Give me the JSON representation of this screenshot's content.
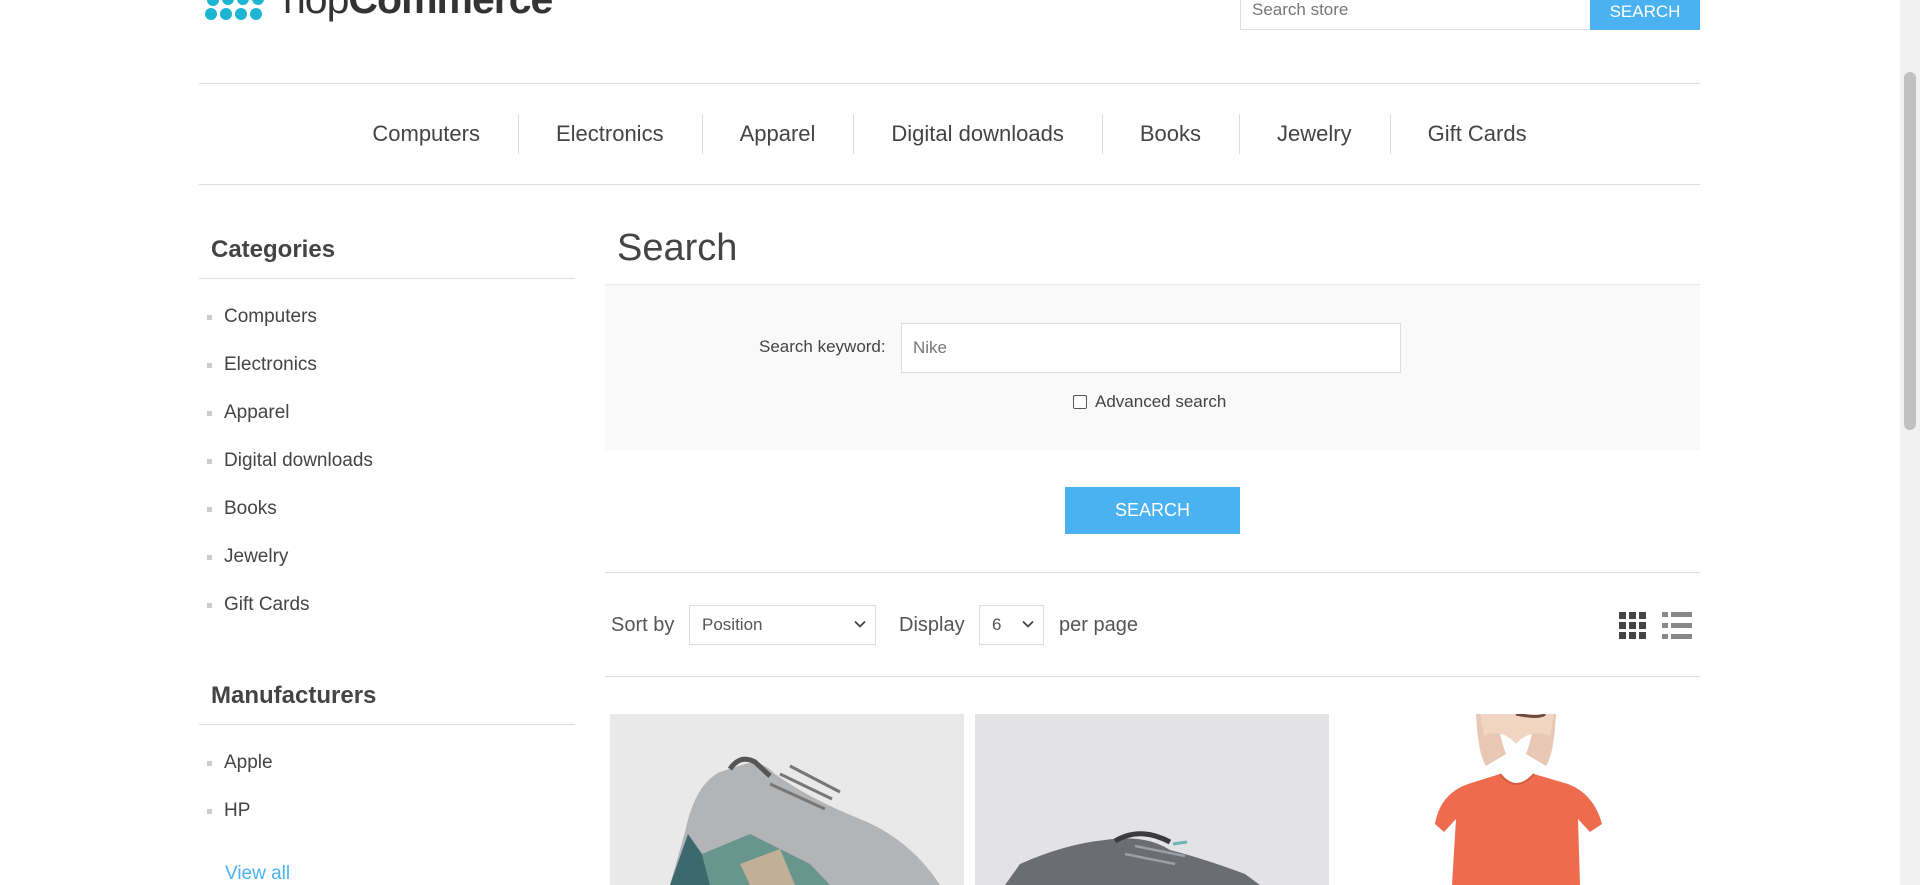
{
  "header": {
    "logo_text_light": "nop",
    "logo_text_bold": "Commerce",
    "search_placeholder": "Search store",
    "search_button": "Search"
  },
  "top_menu": [
    "Computers",
    "Electronics",
    "Apparel",
    "Digital downloads",
    "Books",
    "Jewelry",
    "Gift Cards"
  ],
  "sidebar": {
    "categories_title": "Categories",
    "categories": [
      "Computers",
      "Electronics",
      "Apparel",
      "Digital downloads",
      "Books",
      "Jewelry",
      "Gift Cards"
    ],
    "manufacturers_title": "Manufacturers",
    "manufacturers": [
      "Apple",
      "HP"
    ],
    "view_all": "View all"
  },
  "main": {
    "title": "Search",
    "keyword_label": "Search keyword:",
    "keyword_value": "Nike",
    "advanced_label": "Advanced search",
    "advanced_checked": false,
    "search_button": "Search",
    "sort_label": "Sort by",
    "sort_value": "Position",
    "display_label": "Display",
    "display_value": "6",
    "per_page_label": "per page",
    "products": [
      {
        "image": "grey-sneaker-image"
      },
      {
        "image": "dark-sneaker-image"
      },
      {
        "image": "orange-tshirt-image"
      }
    ]
  },
  "colors": {
    "accent": "#4ab2f1",
    "text": "#444444",
    "panel": "#f9f9f9",
    "border": "#dddddd"
  }
}
